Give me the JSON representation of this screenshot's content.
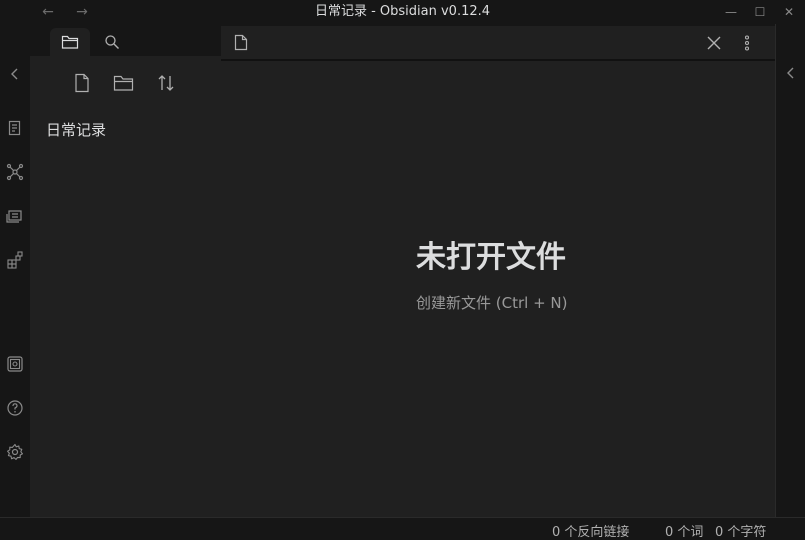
{
  "window": {
    "title": "日常记录 - Obsidian v0.12.4",
    "back_icon": "←",
    "forward_icon": "→",
    "minimize_icon": "—",
    "maximize_icon": "☐",
    "close_icon": "✕"
  },
  "ribbon": {
    "icons": [
      "collapse-left-icon",
      "open-quick-switcher-icon",
      "graph-view-icon",
      "open-starred-icon",
      "plugins-icon",
      "open-vault-icon",
      "help-icon",
      "settings-icon"
    ]
  },
  "sidebar": {
    "tabs": [
      "file-explorer-icon",
      "search-icon"
    ],
    "actions": [
      "new-note-icon",
      "new-folder-icon",
      "sort-icon"
    ],
    "vault_name": "日常记录"
  },
  "editor": {
    "empty_title": "未打开文件",
    "create_action": "创建新文件 (Ctrl + N)"
  },
  "statusbar": {
    "backlinks": "0 个反向链接",
    "words": "0 个词",
    "characters": "0 个字符"
  },
  "colors": {
    "background": "#161616",
    "pane": "#202020",
    "text": "#dcddde",
    "muted": "#999999"
  }
}
